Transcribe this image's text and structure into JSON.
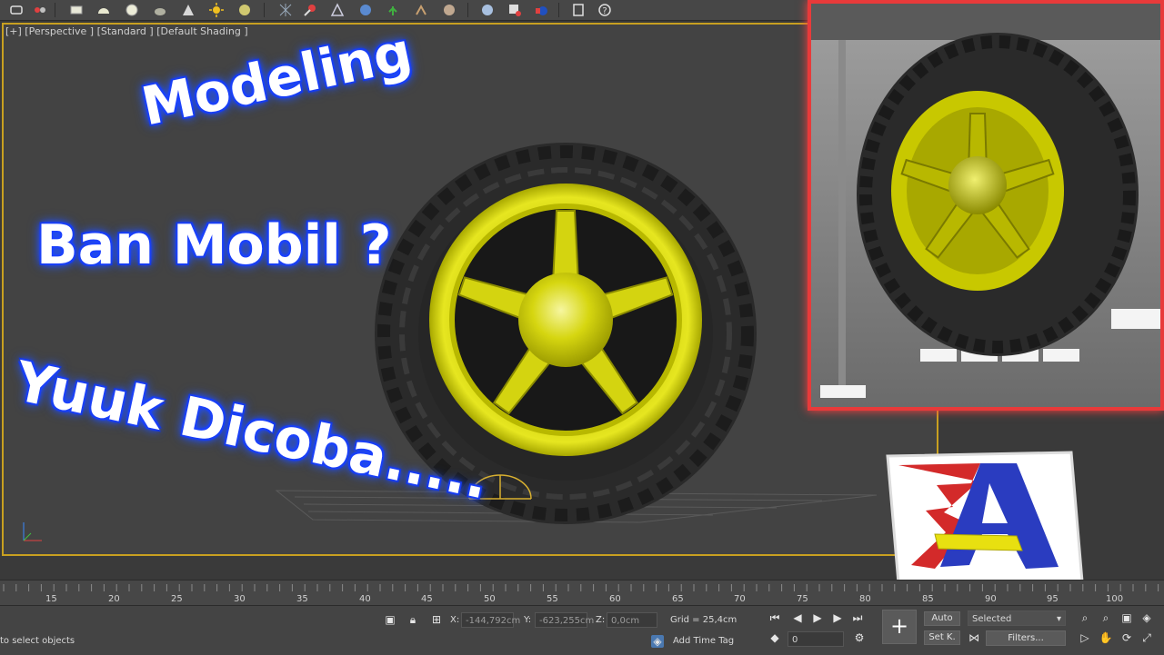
{
  "viewport": {
    "label": "[+] [Perspective ] [Standard ] [Default Shading ]"
  },
  "overlay": {
    "line1": "Modeling",
    "line2": "Ban Mobil ?",
    "line3": "Yuuk Dicoba....."
  },
  "timeline": {
    "ticks": [
      "15",
      "20",
      "25",
      "30",
      "35",
      "40",
      "45",
      "50",
      "55",
      "60",
      "65",
      "70",
      "75",
      "80",
      "85",
      "90",
      "95",
      "100"
    ]
  },
  "status": {
    "prompt": "to select objects",
    "x_label": "X:",
    "x_value": "-144,792cm",
    "y_label": "Y:",
    "y_value": "-623,255cm",
    "z_label": "Z:",
    "z_value": "0,0cm",
    "grid": "Grid = 25,4cm",
    "add_time_tag": "Add Time Tag",
    "frame_value": "0",
    "auto_label": "Auto",
    "setk_label": "Set K.",
    "selected_option": "Selected",
    "filters_label": "Filters..."
  },
  "colors": {
    "viewport_border": "#c8a020",
    "render_border": "#e83a3a",
    "rim": "#d8d80c",
    "glow": "#1a3cff"
  }
}
